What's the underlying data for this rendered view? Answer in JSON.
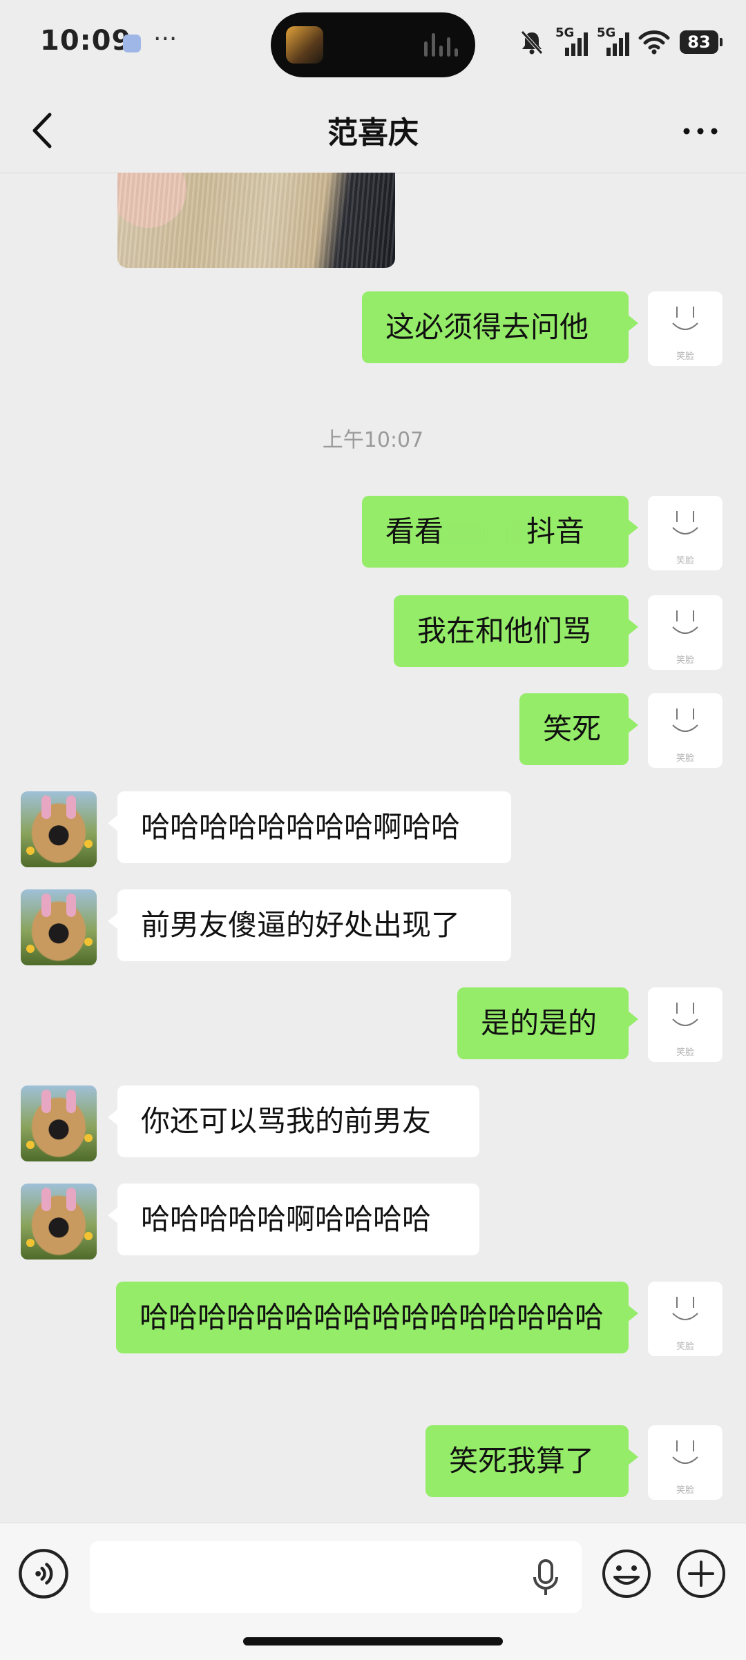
{
  "status_bar": {
    "time": "10:09",
    "more": "···",
    "network_1": "5G",
    "network_2": "5G",
    "battery": "83",
    "icons": [
      "app-badge-icon",
      "mute-bell-icon",
      "signal-icon",
      "wifi-icon",
      "battery-icon"
    ]
  },
  "header": {
    "title": "范喜庆",
    "back_icon": "chevron-left-icon",
    "more_icon": "ellipsis-icon"
  },
  "chat": {
    "timestamp": "上午10:07",
    "my_avatar_caption": "笑脸",
    "messages": [
      {
        "from": "me",
        "text": "这必须得去问他"
      },
      {
        "from": "me",
        "text_before": "看看",
        "text_after": "抖音"
      },
      {
        "from": "me",
        "text": "我在和他们骂"
      },
      {
        "from": "me",
        "text": "笑死"
      },
      {
        "from": "them",
        "text": "哈哈哈哈哈哈哈哈啊哈哈"
      },
      {
        "from": "them",
        "text": "前男友傻逼的好处出现了"
      },
      {
        "from": "me",
        "text": "是的是的"
      },
      {
        "from": "them",
        "text": "你还可以骂我的前男友"
      },
      {
        "from": "them",
        "text": "哈哈哈哈哈啊哈哈哈哈"
      },
      {
        "from": "me",
        "text": "哈哈哈哈哈哈哈哈哈哈哈哈哈哈哈哈"
      },
      {
        "from": "me",
        "text": "笑死我算了"
      }
    ]
  },
  "input_bar": {
    "icons": [
      "voice-icon",
      "microphone-icon",
      "emoji-icon",
      "plus-icon"
    ],
    "placeholder": ""
  },
  "colors": {
    "my_bubble": "#95ec69",
    "their_bubble": "#ffffff",
    "background": "#ededed"
  }
}
